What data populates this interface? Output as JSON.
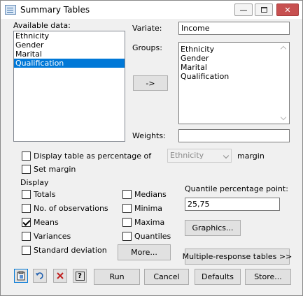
{
  "window": {
    "title": "Summary Tables"
  },
  "available_data": {
    "label": "Available data:",
    "items": [
      "Ethnicity",
      "Gender",
      "Marital",
      "Qualification"
    ],
    "selected_index": 3
  },
  "variate": {
    "label": "Variate:",
    "value": "Income"
  },
  "groups": {
    "label": "Groups:",
    "items": [
      "Ethnicity",
      "Gender",
      "Marital",
      "Qualification"
    ]
  },
  "arrow_button": {
    "label": "->"
  },
  "weights": {
    "label": "Weights:",
    "value": ""
  },
  "display_percentage": {
    "label": "Display table as percentage of",
    "checked": false,
    "combo_value": "Ethnicity",
    "suffix": "margin"
  },
  "set_margin": {
    "label": "Set margin",
    "checked": false
  },
  "display": {
    "group_label": "Display",
    "options": [
      {
        "key": "totals",
        "label": "Totals",
        "checked": false
      },
      {
        "key": "observations",
        "label": "No. of observations",
        "checked": false
      },
      {
        "key": "means",
        "label": "Means",
        "checked": true
      },
      {
        "key": "variances",
        "label": "Variances",
        "checked": false
      },
      {
        "key": "sd",
        "label": "Standard deviation",
        "checked": false
      },
      {
        "key": "medians",
        "label": "Medians",
        "checked": false
      },
      {
        "key": "minima",
        "label": "Minima",
        "checked": false
      },
      {
        "key": "maxima",
        "label": "Maxima",
        "checked": false
      },
      {
        "key": "quantiles",
        "label": "Quantiles",
        "checked": false
      }
    ],
    "more_label": "More..."
  },
  "quantile": {
    "label": "Quantile percentage point:",
    "value": "25,75"
  },
  "graphics_button": {
    "label": "Graphics..."
  },
  "multiple_response_button": {
    "label": "Multiple-response tables >>"
  },
  "footer": {
    "run": "Run",
    "cancel": "Cancel",
    "defaults": "Defaults",
    "store": "Store...",
    "help_icon_label": "?"
  },
  "colors": {
    "selection": "#0078d7",
    "close_button": "#c75050",
    "dialog_bg": "#f0f0f0"
  }
}
